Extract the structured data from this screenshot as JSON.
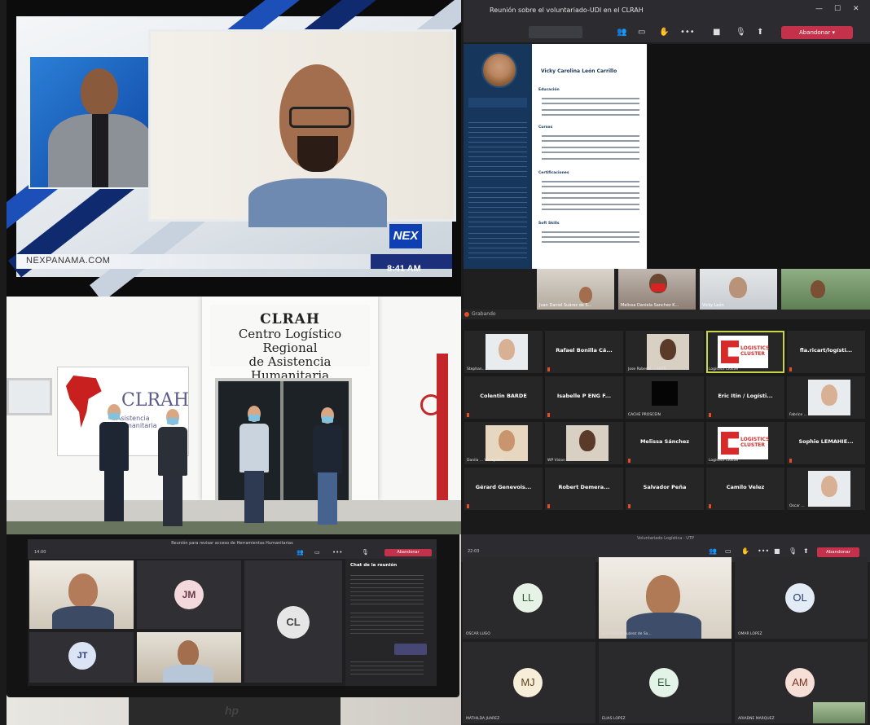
{
  "tv": {
    "site": "NEXPANAMA.COM",
    "logo": "NEX",
    "time": "8:41 AM"
  },
  "teams_meeting": {
    "title": "Reunión sobre el voluntariado-UDI en el CLRAH",
    "leave_label": "Abandonar",
    "document": {
      "name": "Vicky Carolina León Carrillo",
      "sections": [
        "Educación",
        "Cursos",
        "Certificaciones",
        "Soft Skills"
      ]
    },
    "participants": [
      {
        "label": "Juan Daniel Suárez de S..."
      },
      {
        "label": "Melissa Daniela Sanchez K..."
      },
      {
        "label": "Vicky León"
      }
    ]
  },
  "building": {
    "sign_line1": "CLRAH",
    "sign_line2": "Centro Logístico Regional",
    "sign_line3": "de Asistencia Humanitaria",
    "logo_text": "CLRAH",
    "logo_sub": "Asistencia Humanitaria"
  },
  "zoom_grid": {
    "record_label": "Grabando",
    "tiles": [
      {
        "name": "",
        "small": "Stephan..."
      },
      {
        "name": "Rafael Bonilla Cá...",
        "small": ""
      },
      {
        "name": "",
        "small": "Jose Roberto ... LOTE ..."
      },
      {
        "name": "",
        "small": "Logistics Cluster"
      },
      {
        "name": "fla.ricart/logísti...",
        "small": ""
      },
      {
        "name": "Colentin BARDE",
        "small": ""
      },
      {
        "name": "Isabelle P ENG F...",
        "small": ""
      },
      {
        "name": "",
        "small": "CACHE PROSCEIN"
      },
      {
        "name": "Eric Itin / Logísti...",
        "small": ""
      },
      {
        "name": "",
        "small": "Fabrice ..."
      },
      {
        "name": "",
        "small": "Danila ... Venepresa"
      },
      {
        "name": "",
        "small": "WP Vision ..."
      },
      {
        "name": "Melissa Sánchez",
        "small": ""
      },
      {
        "name": "",
        "small": "Logistics Cluster"
      },
      {
        "name": "Sophie LEMAHIE...",
        "small": ""
      },
      {
        "name": "Gérard Genevois...",
        "small": ""
      },
      {
        "name": "Robert Demera...",
        "small": ""
      },
      {
        "name": "Salvador Peña",
        "small": ""
      },
      {
        "name": "Camilo Velez",
        "small": ""
      },
      {
        "name": "",
        "small": "Oscar ..."
      }
    ],
    "logo_line1": "LOGISTICS",
    "logo_line2": "CLUSTER"
  },
  "monitor": {
    "title": "Reunión para revisar acceso de Herramientas Humanitarias",
    "leave_label": "Abandonar",
    "chat_title": "Chat de la reunión",
    "avatars": [
      "JM",
      "CL",
      "JT"
    ],
    "brand": "hp"
  },
  "teams_grid": {
    "title": "Voluntariado Logística - UTP",
    "leave_label": "Abandonar",
    "tiles": [
      {
        "initials": "LL",
        "name": "OSCAR LUGO"
      },
      {
        "initials": "",
        "name": "Juan Daniel Suárez de Sa..."
      },
      {
        "initials": "OL",
        "name": "OMAR LOPEZ"
      },
      {
        "initials": "MJ",
        "name": "MATHILDA JUAREZ"
      },
      {
        "initials": "EL",
        "name": "ELIAS LOPEZ"
      },
      {
        "initials": "AM",
        "name": "ARIADNE MARQUEZ"
      }
    ]
  }
}
